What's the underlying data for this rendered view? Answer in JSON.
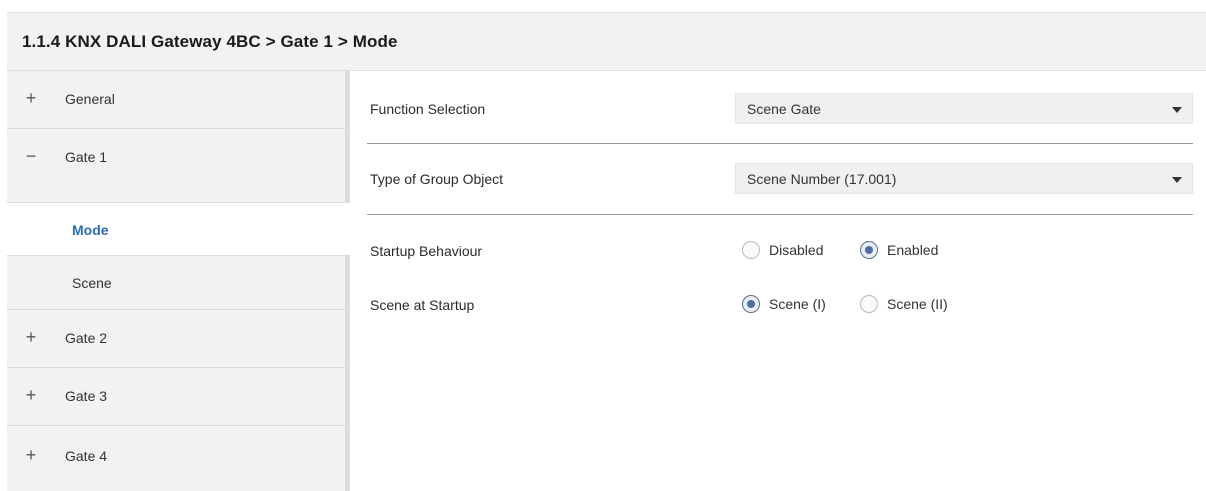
{
  "header": {
    "title": "1.1.4 KNX DALI Gateway 4BC > Gate 1 > Mode"
  },
  "sidebar": {
    "items": [
      {
        "sign": "+",
        "label": "General"
      },
      {
        "sign": "−",
        "label": "Gate 1"
      },
      {
        "label": "Mode"
      },
      {
        "label": "Scene"
      },
      {
        "sign": "+",
        "label": "Gate 2"
      },
      {
        "sign": "+",
        "label": "Gate 3"
      },
      {
        "sign": "+",
        "label": "Gate 4"
      }
    ]
  },
  "params": {
    "function_selection": {
      "label": "Function Selection",
      "value": "Scene Gate"
    },
    "group_object_type": {
      "label": "Type of Group Object",
      "value": "Scene Number (17.001)"
    },
    "startup_behaviour": {
      "label": "Startup Behaviour",
      "options": [
        "Disabled",
        "Enabled"
      ],
      "selected": "Enabled"
    },
    "scene_at_startup": {
      "label": "Scene at Startup",
      "options": [
        "Scene (I)",
        "Scene (II)"
      ],
      "selected": "Scene (I)"
    }
  },
  "colors": {
    "active_nav": "#2a6cb3",
    "radio_checked": "#4d6fa6",
    "sidebar_bg": "#f2f2f2"
  }
}
